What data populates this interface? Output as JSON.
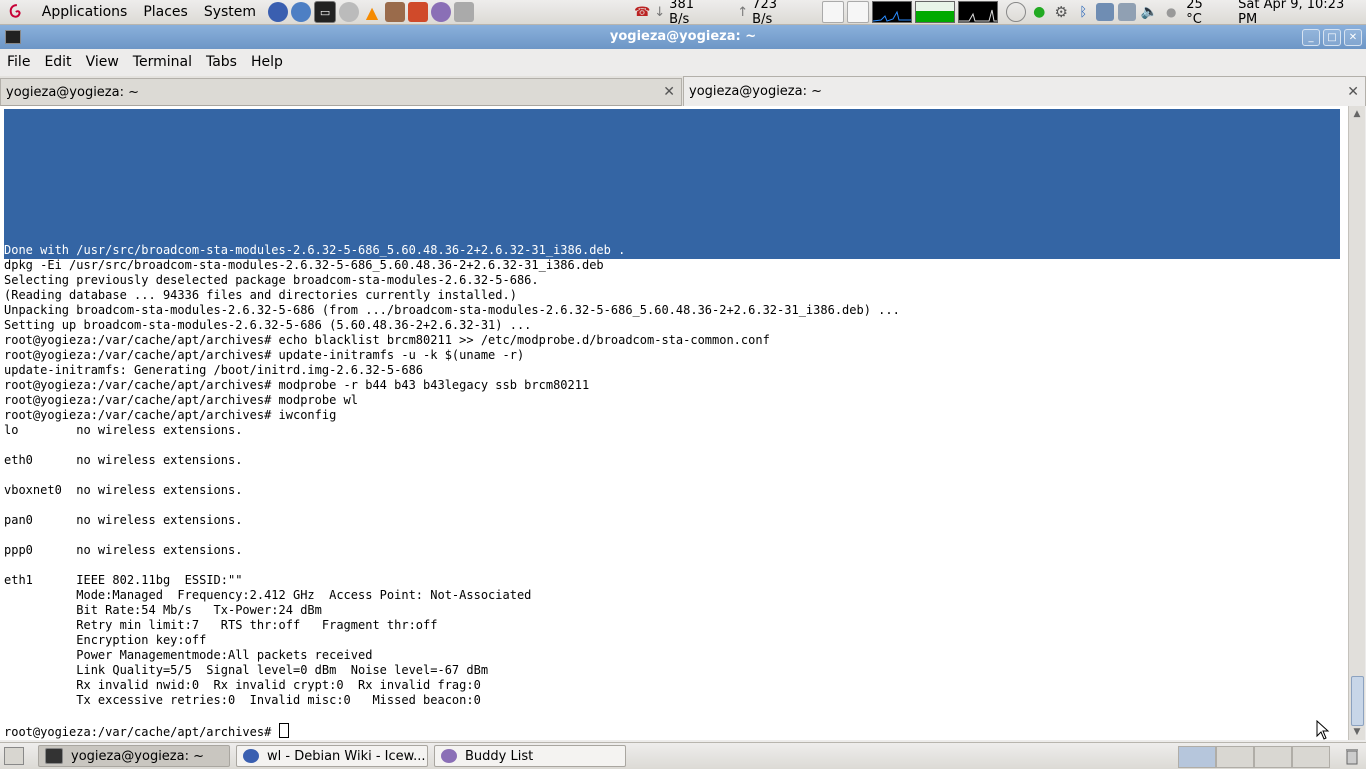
{
  "top_panel": {
    "menus": [
      "Applications",
      "Places",
      "System"
    ],
    "net_down": "381 B/s",
    "net_up": "723 B/s",
    "temperature": "25 °C",
    "clock": "Sat Apr  9, 10:23 PM"
  },
  "window": {
    "title": "yogieza@yogieza: ~"
  },
  "menubar": [
    "File",
    "Edit",
    "View",
    "Terminal",
    "Tabs",
    "Help"
  ],
  "tabs": [
    {
      "label": "yogieza@yogieza: ~",
      "active": false
    },
    {
      "label": "yogieza@yogieza: ~",
      "active": true
    }
  ],
  "terminal": {
    "lines": [
      "Done with /usr/src/broadcom-sta-modules-2.6.32-5-686_5.60.48.36-2+2.6.32-31_i386.deb .",
      "dpkg -Ei /usr/src/broadcom-sta-modules-2.6.32-5-686_5.60.48.36-2+2.6.32-31_i386.deb",
      "Selecting previously deselected package broadcom-sta-modules-2.6.32-5-686.",
      "(Reading database ... 94336 files and directories currently installed.)",
      "Unpacking broadcom-sta-modules-2.6.32-5-686 (from .../broadcom-sta-modules-2.6.32-5-686_5.60.48.36-2+2.6.32-31_i386.deb) ...",
      "Setting up broadcom-sta-modules-2.6.32-5-686 (5.60.48.36-2+2.6.32-31) ...",
      "root@yogieza:/var/cache/apt/archives# echo blacklist brcm80211 >> /etc/modprobe.d/broadcom-sta-common.conf",
      "root@yogieza:/var/cache/apt/archives# update-initramfs -u -k $(uname -r)",
      "update-initramfs: Generating /boot/initrd.img-2.6.32-5-686",
      "root@yogieza:/var/cache/apt/archives# modprobe -r b44 b43 b43legacy ssb brcm80211",
      "root@yogieza:/var/cache/apt/archives# modprobe wl",
      "root@yogieza:/var/cache/apt/archives# iwconfig",
      "lo        no wireless extensions.",
      "",
      "eth0      no wireless extensions.",
      "",
      "vboxnet0  no wireless extensions.",
      "",
      "pan0      no wireless extensions.",
      "",
      "ppp0      no wireless extensions.",
      "",
      "eth1      IEEE 802.11bg  ESSID:\"\"",
      "          Mode:Managed  Frequency:2.412 GHz  Access Point: Not-Associated",
      "          Bit Rate:54 Mb/s   Tx-Power:24 dBm",
      "          Retry min limit:7   RTS thr:off   Fragment thr:off",
      "          Encryption key:off",
      "          Power Managementmode:All packets received",
      "          Link Quality=5/5  Signal level=0 dBm  Noise level=-67 dBm",
      "          Rx invalid nwid:0  Rx invalid crypt:0  Rx invalid frag:0",
      "          Tx excessive retries:0  Invalid misc:0   Missed beacon:0",
      ""
    ],
    "prompt": "root@yogieza:/var/cache/apt/archives# "
  },
  "taskbar": [
    {
      "label": "yogieza@yogieza: ~",
      "active": true,
      "icon": "terminal-icon"
    },
    {
      "label": "wl - Debian Wiki - Icew...",
      "active": false,
      "icon": "iceweasel-icon"
    },
    {
      "label": "Buddy List",
      "active": false,
      "icon": "pidgin-icon"
    }
  ],
  "colors": {
    "selection": "#3465a4",
    "titlebar": "#7aa3d3"
  }
}
